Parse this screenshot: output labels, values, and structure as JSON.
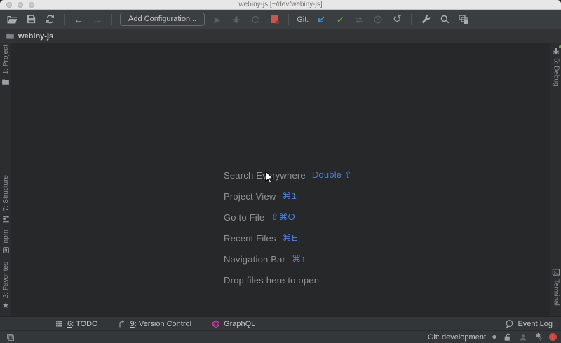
{
  "window": {
    "title": "webiny-js [~/dev/webiny-js]"
  },
  "toolbar": {
    "add_configuration": "Add Configuration...",
    "git_label": "Git:"
  },
  "navbar": {
    "project_name": "webiny-js"
  },
  "tool_window_stripes": {
    "left": [
      {
        "label": "1: Project"
      },
      {
        "label": "7: Structure"
      },
      {
        "label": "npm"
      },
      {
        "label": "2: Favorites"
      }
    ],
    "right": [
      {
        "label": "5: Debug"
      },
      {
        "label": "Terminal"
      }
    ]
  },
  "shortcuts": {
    "rows": [
      {
        "action": "Search Everywhere",
        "keys": "Double ⇧"
      },
      {
        "action": "Project View",
        "keys": "⌘1"
      },
      {
        "action": "Go to File",
        "keys": "⇧⌘O"
      },
      {
        "action": "Recent Files",
        "keys": "⌘E"
      },
      {
        "action": "Navigation Bar",
        "keys": "⌘↑"
      },
      {
        "action": "Drop files here to open",
        "keys": ""
      }
    ]
  },
  "bottom_bar": {
    "todo_mnemonic": "6",
    "todo_label": ": TODO",
    "vcs_mnemonic": "9",
    "vcs_label": ": Version Control",
    "graphql_label": "GraphQL",
    "event_log_label": "Event Log"
  },
  "status_bar": {
    "git_widget": "Git: development"
  },
  "colors": {
    "shortcut_blue": "#4e7dd4",
    "git_update_blue": "#4394d8",
    "commit_green": "#57a64a",
    "stop_red": "#c75450",
    "graphql_pink": "#e535ab",
    "error_red": "#ca4a43"
  }
}
